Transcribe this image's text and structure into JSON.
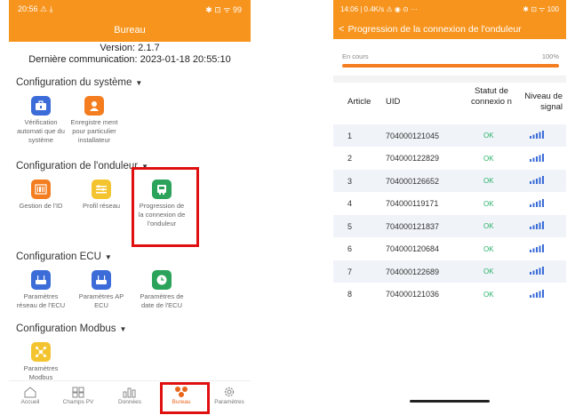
{
  "left": {
    "statusbar": {
      "time": "20:56",
      "icons_left": "⚠ ⤓",
      "icons_right": "✱ ⊡ ᯤ 99"
    },
    "title": "Bureau",
    "version": "Version: 2.1.7",
    "last_comm": "Dernière communication: 2023-01-18 20:55:10",
    "sections": [
      {
        "title": "Configuration du système",
        "items": [
          {
            "label": "Vérification automati que du système",
            "color": "#3b6cd8",
            "icon": "toolbox-icon"
          },
          {
            "label": "Enregistre ment pour particulier installateur",
            "color": "#f47d1f",
            "icon": "user-icon"
          }
        ]
      },
      {
        "title": "Configuration de l'onduleur",
        "items": [
          {
            "label": "Gestion de l'ID",
            "color": "#f47d1f",
            "icon": "barcode-icon"
          },
          {
            "label": "Profil réseau",
            "color": "#f4c430",
            "icon": "sliders-icon"
          },
          {
            "label": "Progression de la connexion de l'onduleur",
            "color": "#2ba35a",
            "icon": "inverter-icon"
          }
        ]
      },
      {
        "title": "Configuration ECU",
        "items": [
          {
            "label": "Paramètres réseau de l'ECU",
            "color": "#3b6cd8",
            "icon": "router-icon"
          },
          {
            "label": "Paramètres AP ECU",
            "color": "#3b6cd8",
            "icon": "router-icon"
          },
          {
            "label": "Paramètres de date de l'ECU",
            "color": "#2ba35a",
            "icon": "clock-icon"
          }
        ]
      },
      {
        "title": "Configuration Modbus",
        "items": [
          {
            "label": "Paramètres Modbus",
            "color": "#f4c430",
            "icon": "network-icon"
          }
        ]
      }
    ],
    "tabs": [
      {
        "label": "Accueil",
        "icon": "home-icon"
      },
      {
        "label": "Champs PV",
        "icon": "grid-icon"
      },
      {
        "label": "Données",
        "icon": "chart-icon"
      },
      {
        "label": "Bureau",
        "icon": "bureau-icon"
      },
      {
        "label": "Paramètres",
        "icon": "gear-icon"
      }
    ]
  },
  "right": {
    "statusbar": {
      "left": "14:06 | 0.4K/s ⚠ ◉ ⊙ ···",
      "right": "✱ ⊡ ᯤ 100"
    },
    "title": "Progression de la connexion de l'onduleur",
    "progress": {
      "label": "En cours",
      "value": "100%",
      "percent": 100
    },
    "headers": {
      "article": "Article",
      "uid": "UID",
      "status": "Statut de connexio n",
      "signal": "Niveau de signal"
    },
    "rows": [
      {
        "article": "1",
        "uid": "704000121045",
        "status": "OK"
      },
      {
        "article": "2",
        "uid": "704000122829",
        "status": "OK"
      },
      {
        "article": "3",
        "uid": "704000126652",
        "status": "OK"
      },
      {
        "article": "4",
        "uid": "704000119171",
        "status": "OK"
      },
      {
        "article": "5",
        "uid": "704000121837",
        "status": "OK"
      },
      {
        "article": "6",
        "uid": "704000120684",
        "status": "OK"
      },
      {
        "article": "7",
        "uid": "704000122689",
        "status": "OK"
      },
      {
        "article": "8",
        "uid": "704000121036",
        "status": "OK"
      }
    ]
  }
}
